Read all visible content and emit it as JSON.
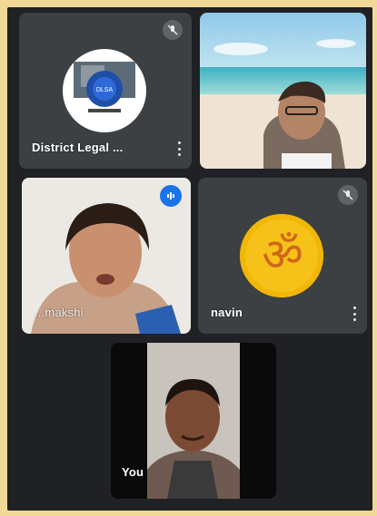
{
  "participants": [
    {
      "name": "District Legal ...",
      "mic": "muted",
      "avatar": "court-logo"
    },
    {
      "name": "",
      "mic": "on",
      "avatar": "camera-video"
    },
    {
      "name": "...makshi",
      "mic": "speaking",
      "avatar": "camera-video"
    },
    {
      "name": "navin",
      "mic": "muted",
      "avatar": "om-symbol"
    },
    {
      "name": "You",
      "mic": "on",
      "avatar": "camera-video"
    }
  ],
  "colors": {
    "background": "#202124",
    "tile": "#3c4043",
    "speaking": "#1a73e8",
    "om": "#f2b705"
  }
}
